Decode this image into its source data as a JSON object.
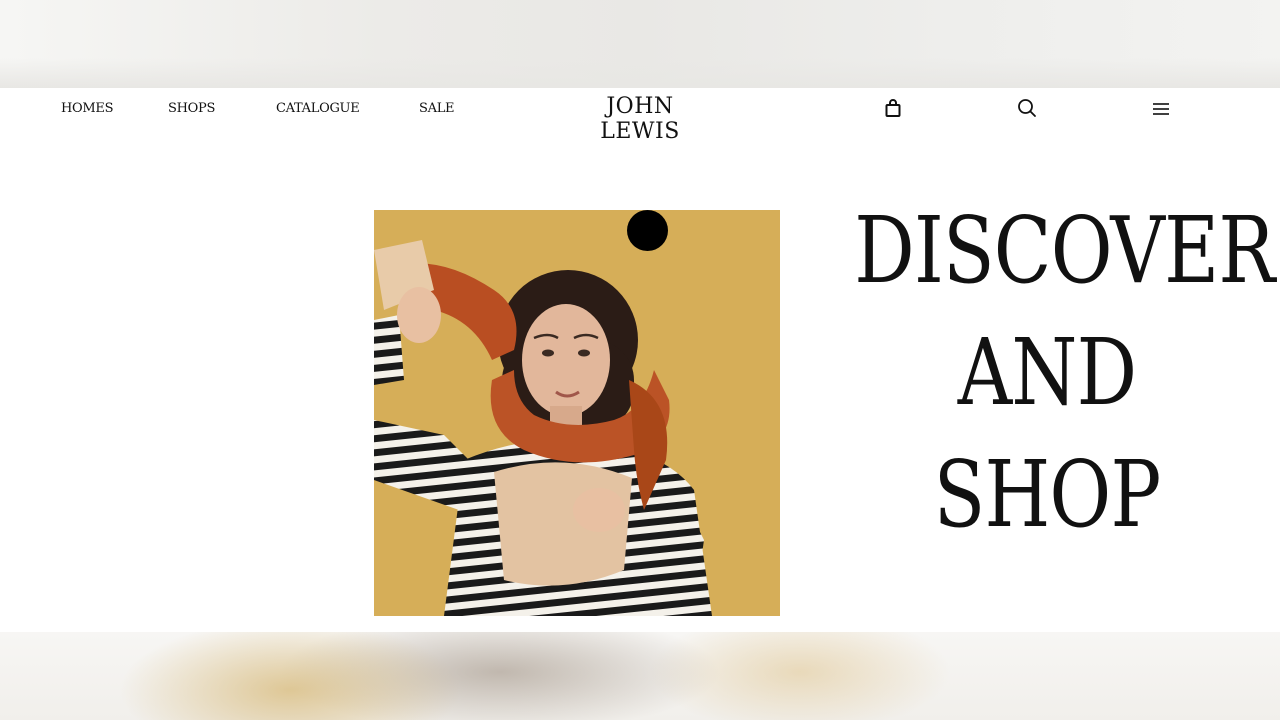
{
  "brand": {
    "logo": "JOHN LEWIS"
  },
  "nav": {
    "links": [
      {
        "label": "HOMES"
      },
      {
        "label": "SHOPS"
      },
      {
        "label": "CATALOGUE"
      },
      {
        "label": "SALE"
      }
    ],
    "icons": [
      "bag-icon",
      "search-icon",
      "menu-icon"
    ]
  },
  "hero": {
    "image_description_icon": "woman-striped-top-fur-scarf-photo",
    "background_color": "#d6ae58",
    "heading_lines": [
      "DISCOVER",
      "AND",
      "SHOP"
    ]
  },
  "colors": {
    "text": "#111111",
    "accent_dot": "#000000",
    "page": "#ffffff"
  }
}
